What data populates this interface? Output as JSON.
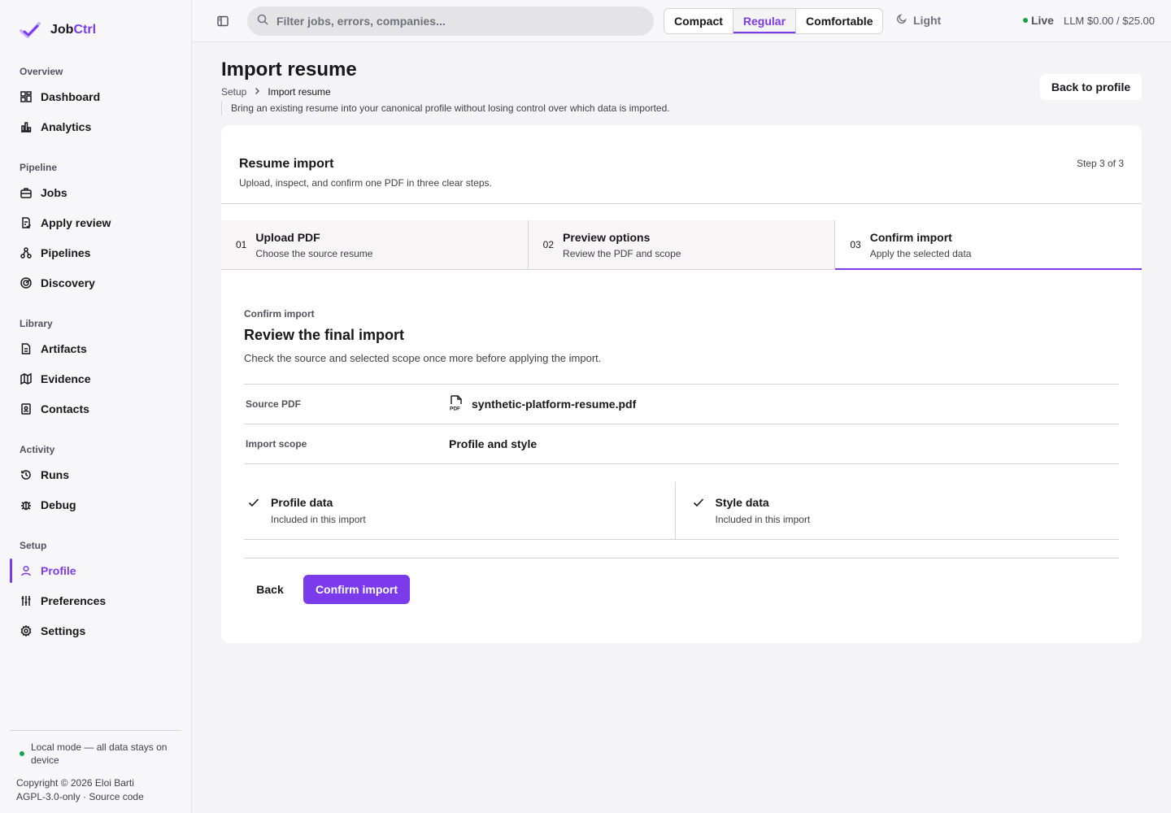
{
  "app": {
    "name_prefix": "Job",
    "name_accent": "Ctrl",
    "accent_color": "#7c3aed"
  },
  "sidebar": {
    "sections": [
      {
        "label": "Overview",
        "items": [
          {
            "label": "Dashboard",
            "icon": "dashboard-icon"
          },
          {
            "label": "Analytics",
            "icon": "bar-chart-icon"
          }
        ]
      },
      {
        "label": "Pipeline",
        "items": [
          {
            "label": "Jobs",
            "icon": "briefcase-icon"
          },
          {
            "label": "Apply review",
            "icon": "clipboard-check-icon"
          },
          {
            "label": "Pipelines",
            "icon": "workflow-icon"
          },
          {
            "label": "Discovery",
            "icon": "radar-icon"
          }
        ]
      },
      {
        "label": "Library",
        "items": [
          {
            "label": "Artifacts",
            "icon": "file-text-icon"
          },
          {
            "label": "Evidence",
            "icon": "map-icon"
          },
          {
            "label": "Contacts",
            "icon": "contact-book-icon"
          }
        ]
      },
      {
        "label": "Activity",
        "items": [
          {
            "label": "Runs",
            "icon": "history-icon"
          },
          {
            "label": "Debug",
            "icon": "bug-icon"
          }
        ]
      },
      {
        "label": "Setup",
        "items": [
          {
            "label": "Profile",
            "icon": "user-icon",
            "active": true
          },
          {
            "label": "Preferences",
            "icon": "sliders-icon"
          },
          {
            "label": "Settings",
            "icon": "gear-icon"
          }
        ]
      }
    ],
    "local_mode": "Local mode — all data stays on device",
    "copyright": "Copyright © 2026 Eloi Barti",
    "license": "AGPL-3.0-only · Source code"
  },
  "topbar": {
    "search_placeholder": "Filter jobs, errors, companies...",
    "density_options": [
      "Compact",
      "Regular",
      "Comfortable"
    ],
    "density_selected": "Regular",
    "theme_label": "Light",
    "live_label": "Live",
    "llm_cost": "LLM $0.00 / $25.00"
  },
  "page": {
    "title": "Import resume",
    "breadcrumb": [
      "Setup",
      "Import resume"
    ],
    "description": "Bring an existing resume into your canonical profile without losing control over which data is imported.",
    "back_button": "Back to profile"
  },
  "card": {
    "title": "Resume import",
    "subtitle": "Upload, inspect, and confirm one PDF in three clear steps.",
    "step_count": "Step 3 of 3",
    "steps": [
      {
        "num": "01",
        "title": "Upload PDF",
        "desc": "Choose the source resume"
      },
      {
        "num": "02",
        "title": "Preview options",
        "desc": "Review the PDF and scope"
      },
      {
        "num": "03",
        "title": "Confirm import",
        "desc": "Apply the selected data",
        "active": true
      }
    ],
    "eyebrow": "Confirm import",
    "section_title": "Review the final import",
    "section_desc": "Check the source and selected scope once more before applying the import.",
    "summary": {
      "source_label": "Source PDF",
      "source_value": "synthetic-platform-resume.pdf",
      "scope_label": "Import scope",
      "scope_value": "Profile and style"
    },
    "includes": [
      {
        "title": "Profile data",
        "desc": "Included in this import"
      },
      {
        "title": "Style data",
        "desc": "Included in this import"
      }
    ],
    "back_label": "Back",
    "confirm_label": "Confirm import"
  }
}
